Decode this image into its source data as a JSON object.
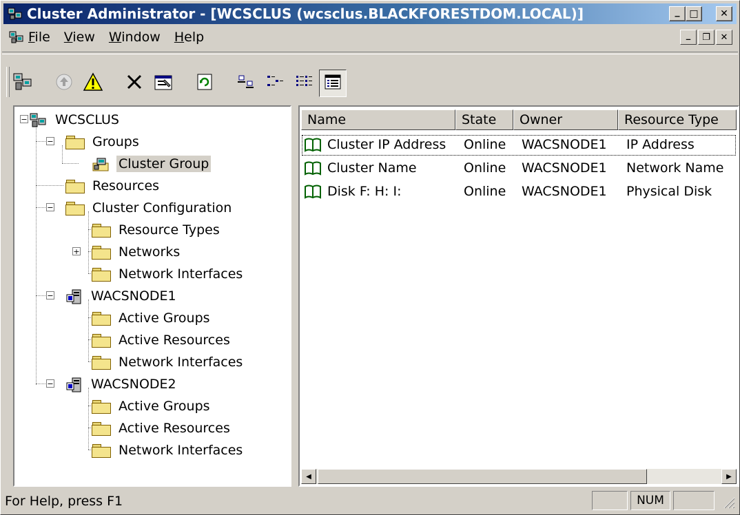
{
  "window": {
    "title": "Cluster Administrator - [WCSCLUS (wcsclus.BLACKFORESTDOM.LOCAL)]",
    "controls": {
      "minimize": "_",
      "maximize": "□",
      "close": "✕"
    }
  },
  "menubar": {
    "items": [
      {
        "label": "File",
        "accel": "F",
        "rest": "ile"
      },
      {
        "label": "View",
        "accel": "V",
        "rest": "iew"
      },
      {
        "label": "Window",
        "accel": "W",
        "rest": "indow"
      },
      {
        "label": "Help",
        "accel": "H",
        "rest": "elp"
      }
    ],
    "mdi_controls": {
      "minimize": "_",
      "restore": "❐",
      "close": "✕"
    }
  },
  "toolbar": {
    "buttons": [
      {
        "icon": "open-connection-icon"
      },
      {
        "icon": "bring-online-icon",
        "disabled": true
      },
      {
        "icon": "take-offline-icon"
      },
      {
        "icon": "delete-icon"
      },
      {
        "icon": "properties-icon"
      },
      {
        "icon": "refresh-icon"
      },
      {
        "icon": "large-icons-view-icon"
      },
      {
        "icon": "small-icons-view-icon"
      },
      {
        "icon": "list-view-icon"
      },
      {
        "icon": "details-view-icon",
        "pressed": true
      }
    ]
  },
  "tree": {
    "root": "WCSCLUS",
    "groups": "Groups",
    "cluster_group": "Cluster Group",
    "resources": "Resources",
    "cluster_configuration": "Cluster Configuration",
    "resource_types": "Resource Types",
    "networks": "Networks",
    "network_interfaces": "Network Interfaces",
    "node1": "WACSNODE1",
    "node1_active_groups": "Active Groups",
    "node1_active_resources": "Active Resources",
    "node1_network_interfaces": "Network Interfaces",
    "node2": "WACSNODE2",
    "node2_active_groups": "Active Groups",
    "node2_active_resources": "Active Resources",
    "node2_network_interfaces": "Network Interfaces",
    "selected": "Cluster Group"
  },
  "list": {
    "columns": [
      "Name",
      "State",
      "Owner",
      "Resource Type"
    ],
    "rows": [
      {
        "name": "Cluster IP Address",
        "state": "Online",
        "owner": "WACSNODE1",
        "type": "IP Address"
      },
      {
        "name": "Cluster Name",
        "state": "Online",
        "owner": "WACSNODE1",
        "type": "Network Name"
      },
      {
        "name": "Disk F: H: I:",
        "state": "Online",
        "owner": "WACSNODE1",
        "type": "Physical Disk"
      }
    ]
  },
  "statusbar": {
    "help_text": "For Help, press F1",
    "num": "NUM"
  },
  "colors": {
    "title_start": "#0a246a",
    "title_end": "#a6caf0",
    "face": "#d4d0c8",
    "folder": "#f4e48c"
  }
}
